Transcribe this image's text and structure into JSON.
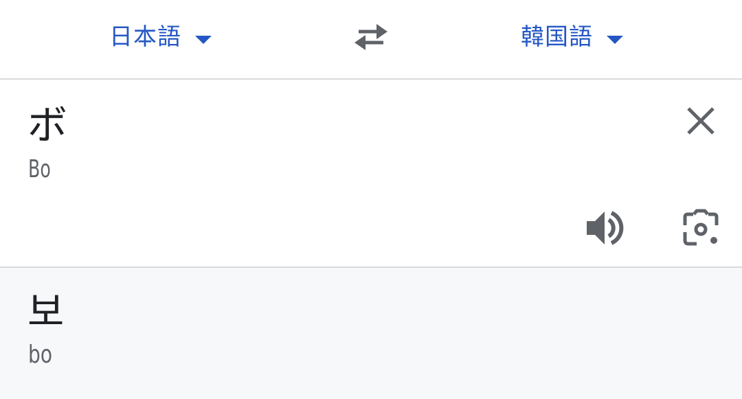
{
  "language_bar": {
    "source_language": "日本語",
    "target_language": "韓国語",
    "source_caret_icon": "caret-down-icon",
    "target_caret_icon": "caret-down-icon",
    "swap_icon": "swap-arrows-icon"
  },
  "source": {
    "text": "ボ",
    "transliteration": "Bo",
    "clear_icon": "close-icon",
    "speak_icon": "volume-icon",
    "lens_icon": "camera-lens-icon"
  },
  "result": {
    "text": "보",
    "transliteration": "bo"
  },
  "colors": {
    "accent": "#2457c5",
    "icon_gray": "#5f6368",
    "result_background": "#f7f8fa",
    "divider": "#d9dadc"
  }
}
